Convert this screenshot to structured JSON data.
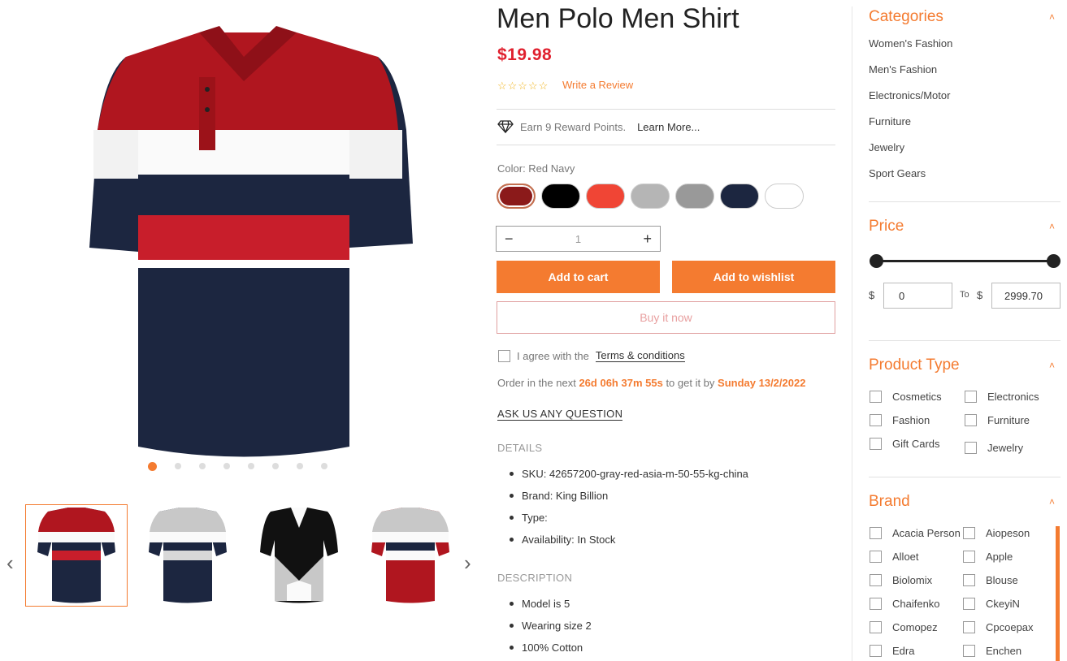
{
  "product": {
    "title": "Men Polo Men Shirt",
    "price": "$19.98",
    "stars": "☆☆☆☆☆",
    "write_review": "Write a Review",
    "reward_text": "Earn 9 Reward Points.",
    "learn_more": "Learn More...",
    "color_label": "Color: Red Navy",
    "swatches": [
      "#8b1a1a",
      "#000000",
      "#f04535",
      "#b5b5b5",
      "#999999",
      "#1c2640",
      "#ffffff"
    ],
    "quantity": "1",
    "add_to_cart": "Add to cart",
    "add_to_wishlist": "Add to wishlist",
    "buy_now": "Buy it now",
    "agree_text": "I agree with the",
    "terms": "Terms & conditions",
    "order_prefix": "Order in the next",
    "countdown": "26d 06h 37m 55s",
    "order_mid": "to get it by",
    "delivery_date": "Sunday 13/2/2022",
    "ask_question": "ASK US ANY QUESTION",
    "details_heading": "DETAILS",
    "details": [
      "SKU: 42657200-gray-red-asia-m-50-55-kg-china",
      "Brand: King Billion",
      "Type:",
      "Availability: In Stock"
    ],
    "description_heading": "DESCRIPTION",
    "description": [
      "Model is 5",
      "Wearing size 2",
      "100% Cotton"
    ]
  },
  "sidebar": {
    "categories_heading": "Categories",
    "categories": [
      "Women's Fashion",
      "Men's Fashion",
      "Electronics/Motor",
      "Furniture",
      "Jewelry",
      "Sport Gears"
    ],
    "price_heading": "Price",
    "currency": "$",
    "price_from": "0",
    "price_to_label": "To",
    "price_to": "2999.70",
    "product_type_heading": "Product Type",
    "product_types": [
      "Cosmetics",
      "Electronics",
      "Fashion",
      "Furniture",
      "Gift Cards",
      "Jewelry"
    ],
    "brand_heading": "Brand",
    "brands": [
      "Acacia Person",
      "Aiopeson",
      "Alloet",
      "Apple",
      "Biolomix",
      "Blouse",
      "Chaifenko",
      "CkeyiN",
      "Comopez",
      "Cpcoepax",
      "Edra",
      "Enchen"
    ]
  },
  "gallery": {
    "slide_count": 8,
    "active_slide": 1
  }
}
